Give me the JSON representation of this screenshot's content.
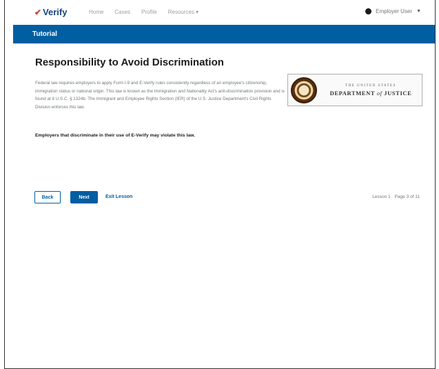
{
  "topnav": {
    "logo_check": "✔",
    "logo_text": "Verify",
    "links": [
      "Home",
      "Cases",
      "Profile",
      "Resources ▾"
    ],
    "user_label": "Employer User",
    "user_caret": "▼"
  },
  "banner": {
    "title": "Tutorial"
  },
  "content": {
    "heading": "Responsibility to Avoid Discrimination",
    "paragraph": "Federal law requires employers to apply Form I-9 and E-Verify rules consistently regardless of an employee's citizenship, immigration status or national origin. This law is known as the Immigration and Nationality Act's anti-discrimination provision and is found at 8 U.S.C. § 1324b. The Immigrant and Employee Rights Section (IER) of the U.S. Justice Department's Civil Rights Division enforces this law.",
    "bold_line": "Employers that discriminate in their use of E-Verify may violate this law.",
    "doj_small": "THE UNITED STATES",
    "doj_big_1": "DEPARTMENT",
    "doj_of": "of",
    "doj_big_2": "JUSTICE"
  },
  "footer": {
    "back_label": "Back",
    "next_label": "Next",
    "exit_label": "Exit Lesson",
    "lesson_label": "Lesson 1",
    "page_label": "Page 3 of 11"
  },
  "colors": {
    "primary": "#005ea2",
    "logo_red": "#d83933",
    "text": "#1b1b1b"
  }
}
